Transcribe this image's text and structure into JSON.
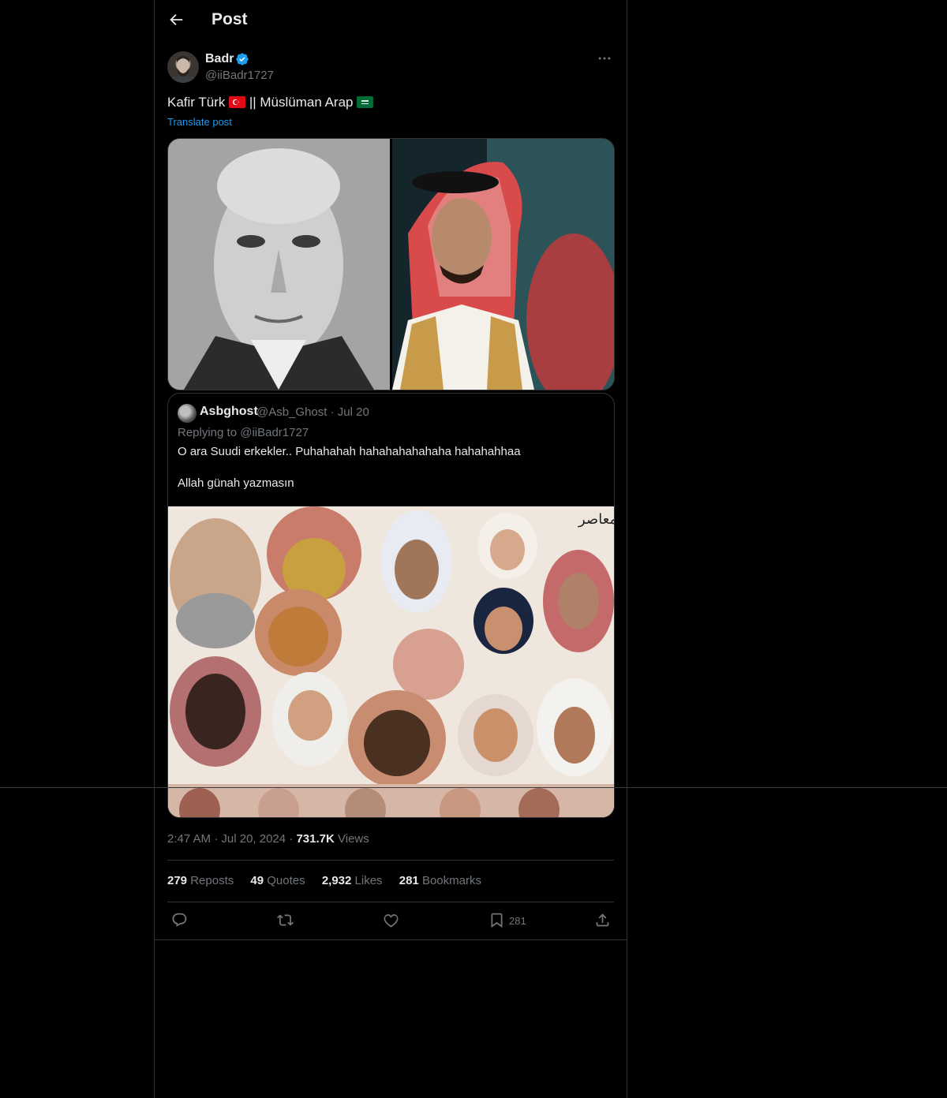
{
  "header": {
    "title": "Post"
  },
  "post": {
    "author_name": "Badr",
    "author_handle": "@iiBadr1727",
    "text_part1": "Kafir Türk ",
    "text_part2": " || Müslüman Arap ",
    "translate": "Translate post",
    "time": "2:47 AM",
    "dot1": "·",
    "date": "Jul 20, 2024",
    "dot2": "·",
    "views_count": "731.7K",
    "views_label": "Views"
  },
  "quote": {
    "author_name": "Asbghost",
    "author_handle": "@Asb_Ghost",
    "dot": "·",
    "date": "Jul 20",
    "replying_prefix": "Replying to ",
    "replying_to": "@iiBadr1727",
    "text_line1": "O ara Suudi erkekler.. Puhahahah hahahahahahaha hahahahhaa",
    "text_line2": "Allah günah yazmasın"
  },
  "stats": {
    "reposts_count": "279",
    "reposts_label": "Reposts",
    "quotes_count": "49",
    "quotes_label": "Quotes",
    "likes_count": "2,932",
    "likes_label": "Likes",
    "bookmarks_count": "281",
    "bookmarks_label": "Bookmarks"
  },
  "actions": {
    "bookmark_count": "281"
  },
  "icons": [
    "back-arrow-icon",
    "verified-badge-icon",
    "more-icon",
    "turkey-flag-icon",
    "saudi-flag-icon",
    "reply-icon",
    "repost-icon",
    "like-icon",
    "bookmark-icon",
    "share-icon"
  ],
  "colors": {
    "accent": "#1d9bf0",
    "muted": "#71767b",
    "text": "#e7e9ea",
    "border": "#2f3336"
  }
}
